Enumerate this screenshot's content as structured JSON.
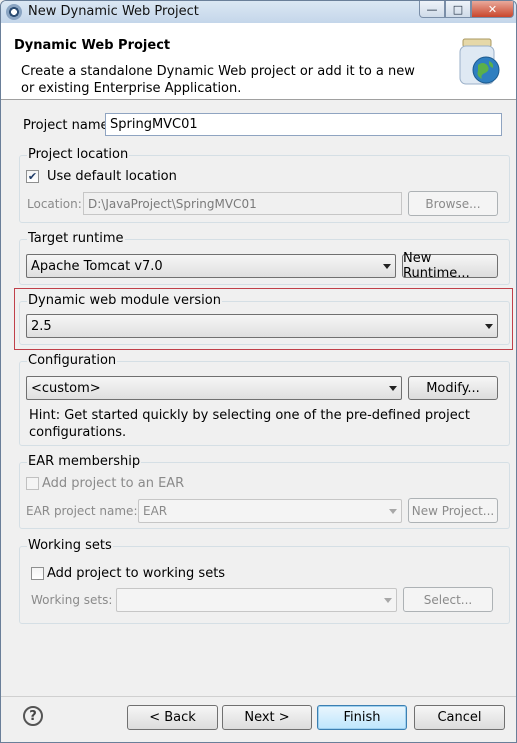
{
  "window": {
    "title": "New Dynamic Web Project"
  },
  "header": {
    "title": "Dynamic Web Project",
    "description": "Create a standalone Dynamic Web project or add it to a new or existing Enterprise Application."
  },
  "project_name": {
    "label": "Project name:",
    "value": "SpringMVC01"
  },
  "project_location": {
    "group_label": "Project location",
    "use_default_label": "Use default location",
    "use_default_checked": true,
    "location_label": "Location:",
    "location_value": "D:\\JavaProject\\SpringMVC01",
    "browse_label": "Browse..."
  },
  "target_runtime": {
    "group_label": "Target runtime",
    "selected": "Apache Tomcat v7.0",
    "new_runtime_label": "New Runtime..."
  },
  "module_version": {
    "group_label": "Dynamic web module version",
    "selected": "2.5"
  },
  "configuration": {
    "group_label": "Configuration",
    "selected": "<custom>",
    "modify_label": "Modify...",
    "hint": "Hint: Get started quickly by selecting one of the pre-defined project configurations."
  },
  "ear_membership": {
    "group_label": "EAR membership",
    "add_label": "Add project to an EAR",
    "ear_name_label": "EAR project name:",
    "ear_name_value": "EAR",
    "new_project_label": "New Project..."
  },
  "working_sets": {
    "group_label": "Working sets",
    "add_label": "Add project to working sets",
    "sets_label": "Working sets:",
    "sets_value": "",
    "select_label": "Select..."
  },
  "footer": {
    "help_symbol": "?",
    "back_label": "< Back",
    "next_label": "Next >",
    "finish_label": "Finish",
    "cancel_label": "Cancel"
  },
  "colors": {
    "highlight_border": "#c0404a",
    "titlebar": "#c4d6ea",
    "close_button": "#c9462c"
  },
  "icons": [
    "eclipse-app-icon",
    "minimize-icon",
    "maximize-icon",
    "close-icon",
    "wizard-banner-icon",
    "checkmark-icon",
    "dropdown-arrow-icon",
    "help-icon"
  ]
}
